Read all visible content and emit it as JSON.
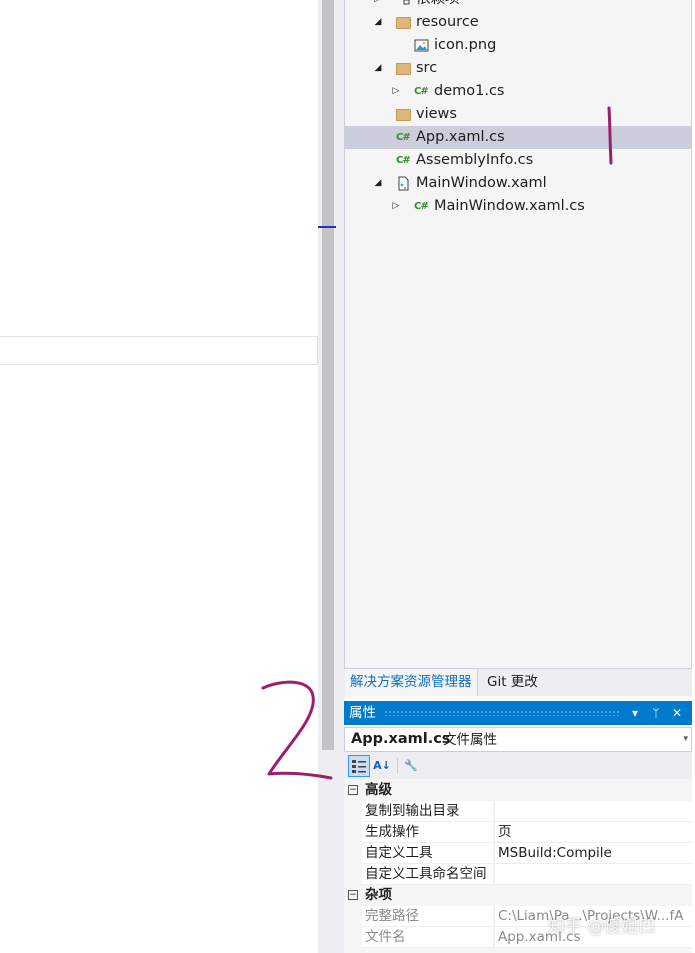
{
  "solution_explorer": {
    "items": [
      {
        "label": "依赖项",
        "kind": "dependencies",
        "expander": "collapsed"
      },
      {
        "label": "resource",
        "kind": "folder",
        "expander": "expanded"
      },
      {
        "label": "icon.png",
        "kind": "image"
      },
      {
        "label": "src",
        "kind": "folder",
        "expander": "expanded"
      },
      {
        "label": "demo1.cs",
        "kind": "csharp",
        "expander": "collapsed"
      },
      {
        "label": "views",
        "kind": "folder"
      },
      {
        "label": "App.xaml.cs",
        "kind": "csharp",
        "selected": true
      },
      {
        "label": "AssemblyInfo.cs",
        "kind": "csharp"
      },
      {
        "label": "MainWindow.xaml",
        "kind": "xaml",
        "expander": "expanded"
      },
      {
        "label": "MainWindow.xaml.cs",
        "kind": "csharp",
        "expander": "collapsed"
      }
    ],
    "cs_icon_text": "C#"
  },
  "tabs": {
    "solution_explorer": "解决方案资源管理器",
    "git_changes": "Git 更改"
  },
  "properties": {
    "title": "属性",
    "object_name": "App.xaml.cs",
    "object_type": "文件属性",
    "categories": [
      {
        "name": "高级",
        "toggle": "⊟",
        "props": [
          {
            "name": "复制到输出目录",
            "value": ""
          },
          {
            "name": "生成操作",
            "value": "页"
          },
          {
            "name": "自定义工具",
            "value": "MSBuild:Compile"
          },
          {
            "name": "自定义工具命名空间",
            "value": ""
          }
        ]
      },
      {
        "name": "杂项",
        "toggle": "⊟",
        "props": [
          {
            "name": "完整路径",
            "value": "C:\\Liam\\Pa...\\Projects\\W...fA",
            "readonly": true
          },
          {
            "name": "文件名",
            "value": "App.xaml.cs",
            "readonly": true
          }
        ]
      }
    ]
  },
  "annotations": {
    "mark_1": "1",
    "mark_2": "2",
    "ink_color": "#9b1f6e"
  },
  "watermark": "知乎 @傻姐凹"
}
